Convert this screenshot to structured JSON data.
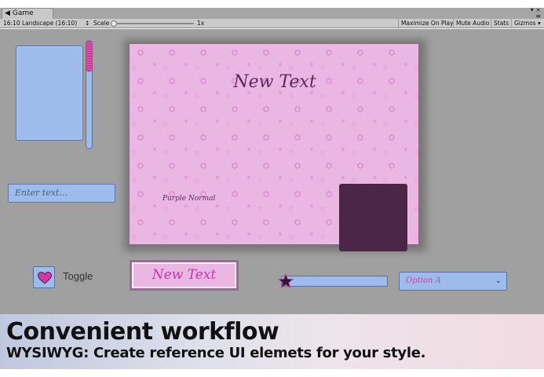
{
  "window": {
    "tab_icon": "game-controller-icon",
    "tab_title": "Game",
    "controls": "▾ ×",
    "menu": "≡"
  },
  "toolbar": {
    "aspect": "16:10 Landscape (16:10)",
    "aspect_arrow": "↕",
    "scale_label": "Scale",
    "scale_value": "1x",
    "maximize_on_play": "Maximize On Play",
    "mute_audio": "Mute Audio",
    "stats": "Stats",
    "gizmos": "Gizmos",
    "gizmos_arrow": "▾"
  },
  "game": {
    "input_placeholder": "Enter text...",
    "panel_title": "New Text",
    "panel_label": "Purple Normal",
    "toggle_label": "Toggle",
    "toggle_on": true,
    "button_label": "New Text",
    "slider_value": 0.0,
    "dropdown_value": "Option A",
    "dropdown_chevron": "⌄"
  },
  "banner": {
    "title": "Convenient workflow",
    "subtitle": "WYSIWYG: Create reference UI elemets for your style."
  },
  "colors": {
    "widget_blue": "#9dbbeb",
    "panel_pink": "#eab6e2",
    "dark_purple": "#4c2649",
    "accent_magenta": "#d33aa8",
    "gameview_gray": "#a0a0a0"
  }
}
